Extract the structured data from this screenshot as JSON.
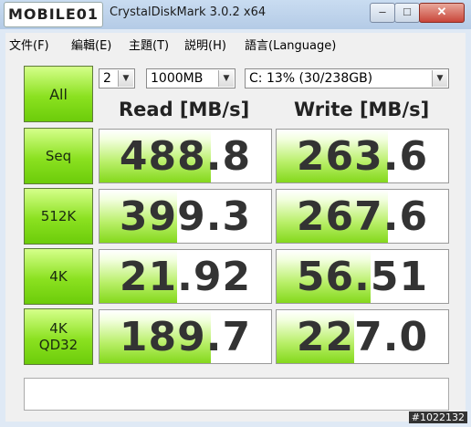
{
  "watermark": "MOBILE01",
  "window": {
    "title": "CrystalDiskMark 3.0.2 x64",
    "minimize": "–",
    "maximize": "□",
    "close": "✕"
  },
  "menu": [
    "文件(F)",
    "編輯(E)",
    "主題(T)",
    "説明(H)",
    "語言(Language)"
  ],
  "controls": {
    "count": "2",
    "size": "1000MB",
    "drive": "C: 13% (30/238GB)",
    "all_label": "All"
  },
  "headers": {
    "read": "Read [MB/s]",
    "write": "Write [MB/s]"
  },
  "rows": [
    {
      "label": "Seq",
      "read": "488.8",
      "write": "263.6",
      "read_fill": 0.65,
      "write_fill": 0.65
    },
    {
      "label": "512K",
      "read": "399.3",
      "write": "267.6",
      "read_fill": 0.45,
      "write_fill": 0.65
    },
    {
      "label": "4K",
      "read": "21.92",
      "write": "56.51",
      "read_fill": 0.45,
      "write_fill": 0.55
    },
    {
      "label": "4K\nQD32",
      "read": "189.7",
      "write": "227.0",
      "read_fill": 0.65,
      "write_fill": 0.45
    }
  ],
  "status_text": "",
  "stamp": "#1022132",
  "colors": {
    "accent_green": "#84d81c",
    "title_bar": "#b4cbe6"
  }
}
